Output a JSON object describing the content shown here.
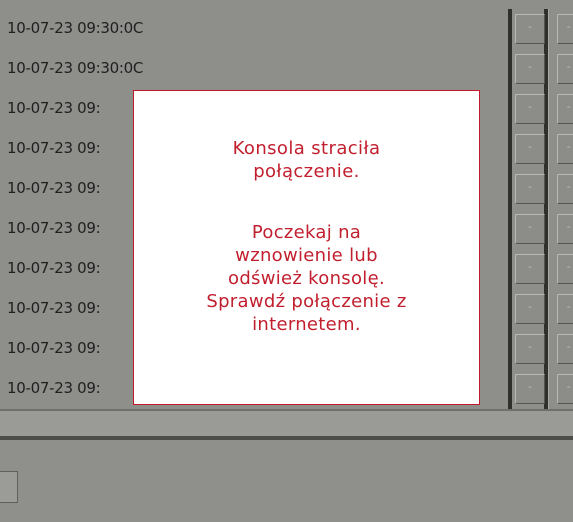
{
  "table": {
    "timestamps": [
      "10-07-23 09:30:0C",
      "10-07-23 09:30:0C",
      "10-07-23 09:",
      "10-07-23 09:",
      "10-07-23 09:",
      "10-07-23 09:",
      "10-07-23 09:",
      "10-07-23 09:",
      "10-07-23 09:",
      "10-07-23 09:"
    ],
    "button_label": "-"
  },
  "dialog": {
    "title_lines": [
      "Konsola straciła",
      "połączenie."
    ],
    "body_lines": [
      "Poczekaj na",
      "wznowienie lub",
      "odśwież konsolę.",
      "Sprawdź połączenie z",
      "internetem."
    ]
  },
  "colors": {
    "background": "#8e8e8b",
    "dialog_text": "#c21f2e",
    "dialog_border": "#c2182c"
  }
}
